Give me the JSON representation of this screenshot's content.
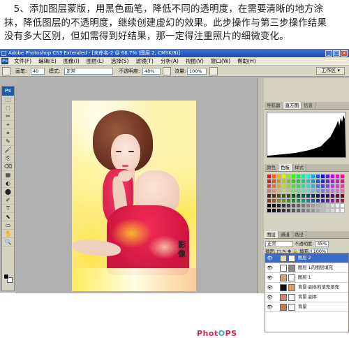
{
  "instruction": {
    "lines": [
      "　5、添加图层蒙版，用黑色画笔，降低不同的透明度，在需要清晰的地方涂",
      "抹，降低图层的不透明度，继续创建虚幻的效果。此步操作与第三步操作结果",
      "没有多大区别，但如需得到好结果，那一定得注重照片的细微变化。"
    ]
  },
  "window": {
    "title": "Adobe Photoshop CS3 Extended - [未命名-2 @ 66.7% (图层 2, CMYK/8)]",
    "app_icon_label": "Ps"
  },
  "menubar": {
    "items": [
      "文件(F)",
      "编辑(E)",
      "图像(I)",
      "图层(L)",
      "选择(S)",
      "滤镜(T)",
      "分析(A)",
      "视图(V)",
      "窗口(W)",
      "帮助(H)"
    ]
  },
  "options": {
    "brush_label": "画笔:",
    "brush_size": "40",
    "mode_label": "模式:",
    "mode_value": "正常",
    "opacity_label": "不透明度:",
    "opacity_value": "48%",
    "flow_label": "流量:",
    "flow_value": "100%"
  },
  "workspace_label": "工作区 ▾",
  "toolbox": {
    "logo": "Ps",
    "tools": [
      "⬚",
      "◌",
      "✂",
      "⌖",
      "⌗",
      "✎",
      "🖌",
      "⎘",
      "⌫",
      "▦",
      "◐",
      "⬤",
      "✐",
      "T",
      "⬉",
      "▭",
      "✋",
      "🔍"
    ]
  },
  "panels": {
    "nav_tabs": [
      "导航器",
      "直方图",
      "信息"
    ],
    "color_tabs": [
      "颜色",
      "色板",
      "样式"
    ],
    "layer_tabs": [
      "图层",
      "通道",
      "路径"
    ],
    "blend_mode": "正常",
    "layer_opacity_label": "不透明度:",
    "layer_opacity": "45%",
    "lock_label": "锁定:",
    "fill_label": "填充:",
    "fill_value": "100%"
  },
  "layers": [
    {
      "name": "图层 2",
      "selected": true
    },
    {
      "name": "图层 1的图层填充",
      "selected": false
    },
    {
      "name": "图层 1",
      "selected": false
    },
    {
      "name": "背景 副本的填充填充",
      "selected": false
    },
    {
      "name": "背景 副本",
      "selected": false
    },
    {
      "name": "背景",
      "selected": false
    }
  ],
  "signature": "影像",
  "watermark": {
    "part1": "Phot",
    "part2": "O",
    "part3": "PS"
  }
}
